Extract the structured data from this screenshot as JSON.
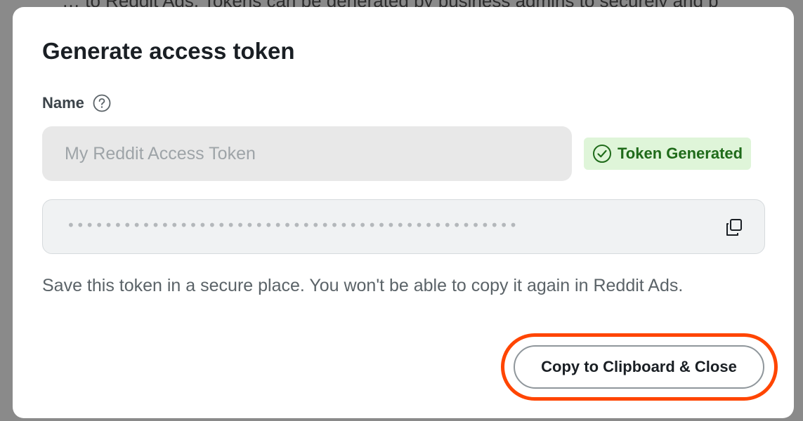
{
  "backdrop": {
    "text": "… to Reddit Ads. Tokens can be generated by business admins to securely and b"
  },
  "modal": {
    "title": "Generate access token",
    "name_label": "Name",
    "name_help_icon": "question-circle-icon",
    "name_input": {
      "value": "",
      "placeholder": "My Reddit Access Token"
    },
    "status_badge": {
      "label": "Token Generated",
      "icon": "check-circle-icon",
      "color": "#1f6b1a",
      "background": "#dff5d9"
    },
    "token_field": {
      "masked_value": "••••••••••••••••••••••••••••••••••••••••••••••••",
      "copy_icon": "copy-icon"
    },
    "helper_text": "Save this token in a secure place. You won't be able to copy it again in Reddit Ads.",
    "primary_button": {
      "label": "Copy to Clipboard & Close",
      "highlight_color": "#ff4500"
    }
  }
}
